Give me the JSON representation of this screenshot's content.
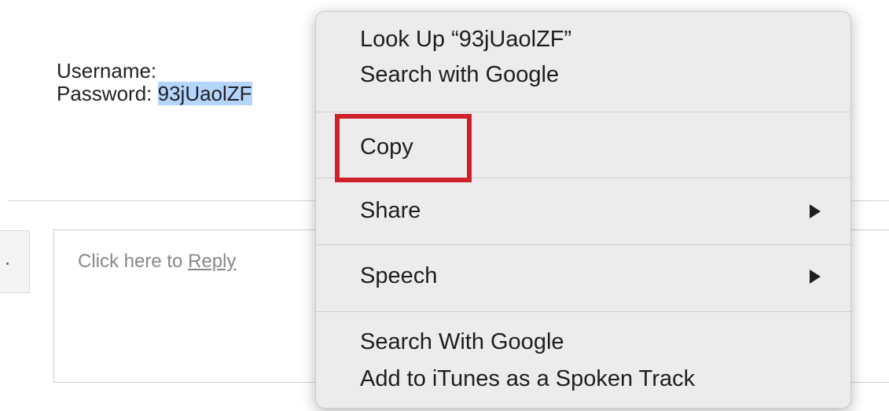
{
  "email": {
    "username_label": "Username:",
    "password_label": "Password:",
    "password_value": "93jUaolZF"
  },
  "reply": {
    "prompt_prefix": "Click here to ",
    "prompt_link": "Reply"
  },
  "context_menu": {
    "look_up": "Look Up “93jUaolZF”",
    "search_with_google": "Search with Google",
    "copy": "Copy",
    "share": "Share",
    "speech": "Speech",
    "search_with_google_service": "Search With Google",
    "add_to_itunes": "Add to iTunes as a Spoken Track"
  },
  "colors": {
    "selection": "#b4d5fe",
    "highlight_border": "#d0202a",
    "menu_background": "#ececec"
  }
}
